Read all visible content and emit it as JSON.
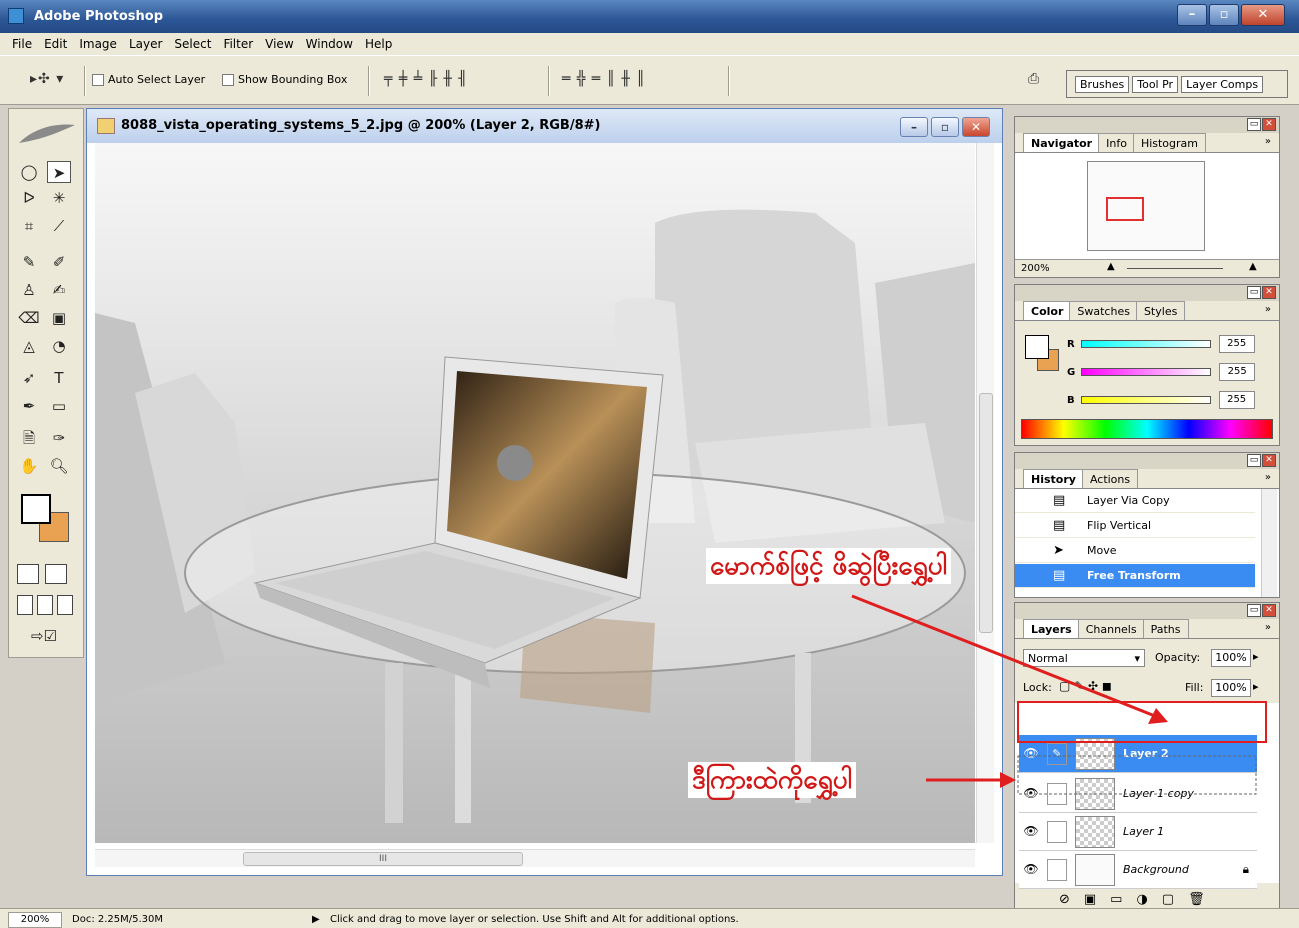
{
  "window": {
    "title": "Adobe Photoshop",
    "btn_min": "–",
    "btn_max": "▫",
    "btn_close": "✕"
  },
  "menu": [
    "File",
    "Edit",
    "Image",
    "Layer",
    "Select",
    "Filter",
    "View",
    "Window",
    "Help"
  ],
  "options": {
    "auto_select_label": "Auto Select Layer",
    "show_bounding_box_label": "Show Bounding Box",
    "well_tabs": [
      "Brushes",
      "Tool Pr",
      "Layer Comps"
    ]
  },
  "document": {
    "title": "8088_vista_operating_systems_5_2.jpg @ 200% (Layer 2, RGB/8#)",
    "hscroll_grip": "III"
  },
  "navigator": {
    "tabs": [
      "Navigator",
      "Info",
      "Histogram"
    ],
    "zoom": "200%",
    "more": "»"
  },
  "color": {
    "tabs": [
      "Color",
      "Swatches",
      "Styles"
    ],
    "r_label": "R",
    "g_label": "G",
    "b_label": "B",
    "r": "255",
    "g": "255",
    "b": "255",
    "fg": "#ffffff",
    "bg": "#e8a252"
  },
  "history": {
    "tabs": [
      "History",
      "Actions"
    ],
    "items": [
      "Layer Via Copy",
      "Flip Vertical",
      "Move",
      "Free Transform"
    ]
  },
  "layers": {
    "tabs": [
      "Layers",
      "Channels",
      "Paths"
    ],
    "blend_mode": "Normal",
    "opacity_label": "Opacity:",
    "opacity": "100%",
    "lock_label": "Lock:",
    "fill_label": "Fill:",
    "fill": "100%",
    "rows": [
      "Layer 2",
      "Layer 1 copy",
      "Layer 1",
      "Background"
    ]
  },
  "annotations": {
    "top": "မောက်စ်ဖြင့် ဖိဆွဲပြီးရွှေ့ပါ",
    "bottom": "ဒီကြားထဲကိုရွှေ့ပါ"
  },
  "status": {
    "zoom": "200%",
    "doc_size": "Doc: 2.25M/5.30M",
    "hint": "Click and drag to move layer or selection.  Use Shift and Alt for additional options."
  }
}
